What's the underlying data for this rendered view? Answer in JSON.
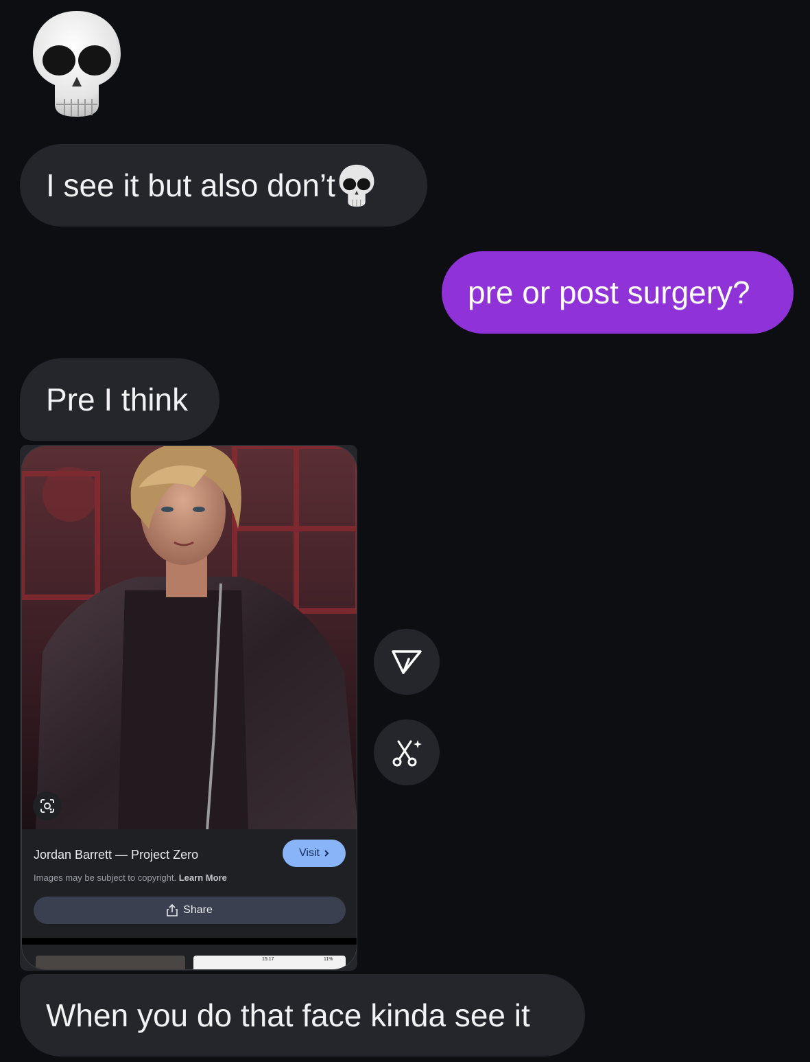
{
  "messages": {
    "m1_emoji": "skull",
    "m2_text": "I see it but also don’t",
    "m3_text": "pre or post surgery?",
    "m4_text": "Pre I think",
    "m5_text": "When you do that face kinda see it"
  },
  "shared_card": {
    "title": "Jordan Barrett — Project Zero",
    "visit_label": "Visit",
    "copyright_text": "Images may be subject to copyright.",
    "learn_more_label": "Learn More",
    "share_label": "Share",
    "status_time": "15:17",
    "battery": "11%"
  },
  "colors": {
    "background": "#0c0e12",
    "incoming_bubble": "#24262b",
    "outgoing_bubble": "#8f33d9",
    "visit_button": "#8ab4f8"
  },
  "icons": {
    "send": "send-icon",
    "sparkle_scissors": "scissors-sparkle-icon",
    "lens": "lens-icon",
    "share": "share-icon"
  }
}
